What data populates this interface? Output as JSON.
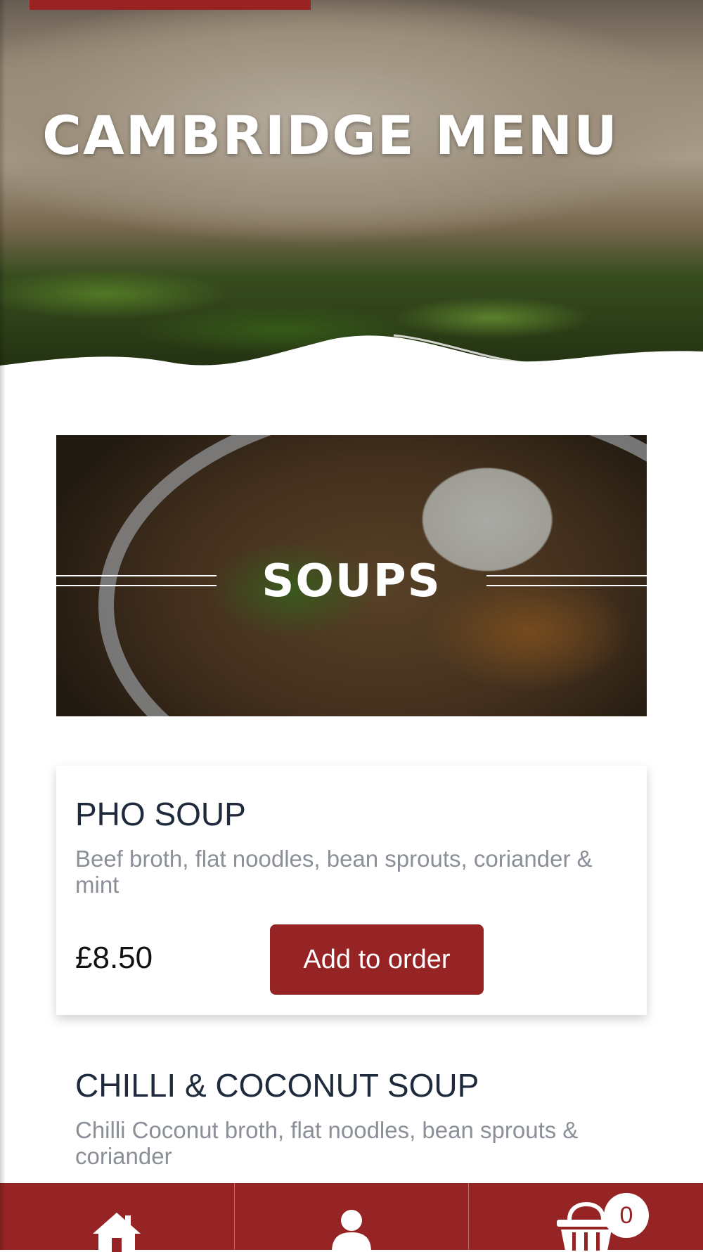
{
  "hero": {
    "title": "CAMBRIDGE MENU"
  },
  "section": {
    "title": "SOUPS"
  },
  "items": [
    {
      "name": "PHO SOUP",
      "description": "Beef broth, flat noodles, bean sprouts, coriander & mint",
      "price": "£8.50",
      "button_label": "Add to order"
    },
    {
      "name": "CHILLI & COCONUT SOUP",
      "description": "Chilli Coconut broth, flat noodles, bean sprouts & coriander"
    }
  ],
  "bottom_nav": {
    "items": [
      {
        "icon": "home-icon"
      },
      {
        "icon": "user-icon"
      },
      {
        "icon": "basket-icon"
      }
    ],
    "cart_count": "0"
  },
  "colors": {
    "accent": "#962424",
    "heading": "#1f2a3c",
    "description": "#8b9098"
  }
}
